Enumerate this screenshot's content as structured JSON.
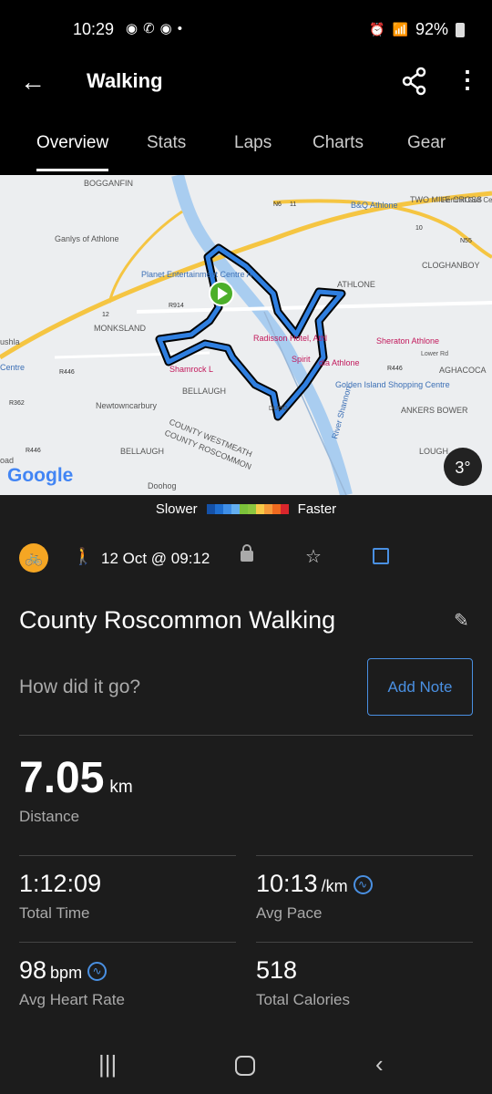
{
  "status": {
    "time": "10:29",
    "notif_icons": [
      "chrome-icon",
      "whatsapp-icon",
      "chrome-icon",
      "dot-icon"
    ],
    "battery": "92%"
  },
  "appbar": {
    "title": "Walking"
  },
  "tabs": [
    {
      "label": "Overview",
      "active": true
    },
    {
      "label": "Stats"
    },
    {
      "label": "Laps"
    },
    {
      "label": "Charts"
    },
    {
      "label": "Gear"
    }
  ],
  "map": {
    "labels": [
      "BOGGANFIN",
      "Ganlys of Athlone",
      "B&Q Athlone",
      "TWO MILE CROSS",
      "Fernhill Golf Centre At",
      "CLOGHANBOY",
      "Planet Entertainment Centre A",
      "ATHLONE",
      "Radisson Hotel, Athl",
      "Sheraton Athlone",
      "ushla",
      "MONKSLAND",
      "Shamrock L",
      "Spirit",
      "dia Athlone",
      "AGHACOCA",
      "Centre",
      "BELLAUGH",
      "Golden Island Shopping Centre",
      "Newtowncarbury",
      "DUOG",
      "ANKERS BOWER",
      "COUNTY WESTMEATH",
      "COUNTY ROSCOMMON",
      "River Shannon",
      "BELLAUGH",
      "LOUGH",
      "Doohog",
      "oad",
      "Lower Rd"
    ],
    "roads": [
      "N6",
      "11",
      "R914",
      "12",
      "R446",
      "R362",
      "R446",
      "N55",
      "10",
      "R446"
    ],
    "logo": "Google",
    "temperature": "3°",
    "route_color": "#2f7fe0"
  },
  "legend": {
    "slower": "Slower",
    "faster": "Faster",
    "colors": [
      "#1451a8",
      "#1f6fd1",
      "#3f8fe8",
      "#63aef0",
      "#7bc13a",
      "#8cc63f",
      "#f7c948",
      "#f59a3a",
      "#ef6a1f",
      "#d9262c"
    ]
  },
  "activity": {
    "date": "12 Oct @ 09:12",
    "name": "County Roscommon Walking",
    "prompt": "How did it go?",
    "add_note": "Add Note"
  },
  "stats": {
    "distance": {
      "value": "7.05",
      "unit": "km",
      "label": "Distance"
    },
    "time": {
      "value": "1:12:09",
      "label": "Total Time"
    },
    "pace": {
      "value": "10:13",
      "unit": "/km",
      "label": "Avg Pace"
    },
    "hr": {
      "value": "98",
      "unit": "bpm",
      "label": "Avg Heart Rate"
    },
    "calories": {
      "value": "518",
      "label": "Total Calories"
    }
  }
}
